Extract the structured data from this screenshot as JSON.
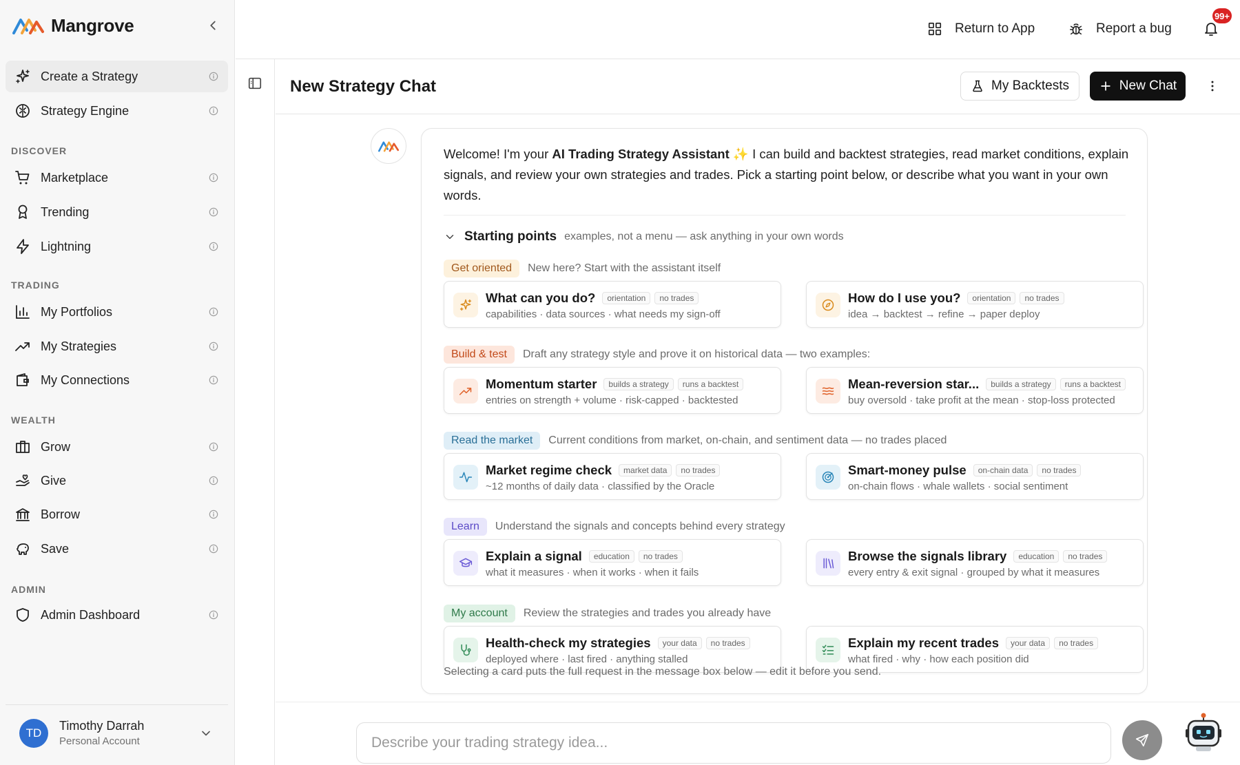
{
  "brand": {
    "name": "Mangrove"
  },
  "sidebar": {
    "primary": [
      {
        "label": "Create a Strategy",
        "icon": "sparkles-icon"
      },
      {
        "label": "Strategy Engine",
        "icon": "brain-icon"
      }
    ],
    "sections": [
      {
        "title": "DISCOVER",
        "items": [
          {
            "label": "Marketplace",
            "icon": "cart-icon"
          },
          {
            "label": "Trending",
            "icon": "award-icon"
          },
          {
            "label": "Lightning",
            "icon": "lightning-icon"
          }
        ]
      },
      {
        "title": "TRADING",
        "items": [
          {
            "label": "My Portfolios",
            "icon": "bar-chart-icon"
          },
          {
            "label": "My Strategies",
            "icon": "trending-up-icon"
          },
          {
            "label": "My Connections",
            "icon": "wallet-icon"
          }
        ]
      },
      {
        "title": "WEALTH",
        "items": [
          {
            "label": "Grow",
            "icon": "briefcase-icon"
          },
          {
            "label": "Give",
            "icon": "hand-heart-icon"
          },
          {
            "label": "Borrow",
            "icon": "bank-icon"
          },
          {
            "label": "Save",
            "icon": "piggy-bank-icon"
          }
        ]
      },
      {
        "title": "ADMIN",
        "items": [
          {
            "label": "Admin Dashboard",
            "icon": "shield-icon"
          }
        ]
      }
    ],
    "user": {
      "initials": "TD",
      "name": "Timothy Darrah",
      "account": "Personal Account"
    }
  },
  "topbar": {
    "return_label": "Return to App",
    "bug_label": "Report a bug",
    "notifications_badge": "99+"
  },
  "chat": {
    "title": "New Strategy Chat",
    "backtests_label": "My Backtests",
    "new_chat_label": "New Chat"
  },
  "welcome": {
    "lead": "Welcome! I'm your ",
    "assistant_name": "AI Trading Strategy Assistant",
    "sparkle": "✨",
    "body": " I can build and backtest strategies, read market conditions, explain signals, and review your own strategies and trades. Pick a starting point below, or describe what you want in your own words."
  },
  "starting_points": {
    "title": "Starting points",
    "subtitle": "examples, not a menu — ask anything in your own words",
    "categories": [
      {
        "label": "Get oriented",
        "desc": "New here? Start with the assistant itself",
        "bg": "#fdf1dc",
        "fg": "#a1581c",
        "options": [
          {
            "name": "What can you do?",
            "tags": [
              "orientation",
              "no trades"
            ],
            "desc": "capabilities · data sources · what needs my sign-off",
            "icon": "sparkles-icon",
            "icon_bg": "#fdf3e3",
            "icon_fg": "#d98a1c"
          },
          {
            "name": "How do I use you?",
            "tags": [
              "orientation",
              "no trades"
            ],
            "desc": "idea → backtest → refine → paper deploy",
            "icon": "compass-icon",
            "icon_bg": "#fdf3e3",
            "icon_fg": "#d98a1c"
          }
        ]
      },
      {
        "label": "Build & test",
        "desc": "Draft any strategy style and prove it on historical data — two examples:",
        "bg": "#fde6dc",
        "fg": "#c24a1a",
        "options": [
          {
            "name": "Momentum starter",
            "tags": [
              "builds a strategy",
              "runs a backtest"
            ],
            "desc": "entries on strength + volume · risk-capped · backtested",
            "icon": "trending-up-icon",
            "icon_bg": "#fdebe2",
            "icon_fg": "#e0622a"
          },
          {
            "name": "Mean-reversion star...",
            "tags": [
              "builds a strategy",
              "runs a backtest"
            ],
            "desc": "buy oversold · take profit at the mean · stop-loss protected",
            "icon": "waves-icon",
            "icon_bg": "#fdebe2",
            "icon_fg": "#e0622a"
          }
        ]
      },
      {
        "label": "Read the market",
        "desc": "Current conditions from market, on-chain, and sentiment data — no trades placed",
        "bg": "#dfeef7",
        "fg": "#2a6f97",
        "options": [
          {
            "name": "Market regime check",
            "tags": [
              "market data",
              "no trades"
            ],
            "desc": "~12 months of daily data · classified by the Oracle",
            "icon": "activity-icon",
            "icon_bg": "#e3f1f8",
            "icon_fg": "#2a86b8"
          },
          {
            "name": "Smart-money pulse",
            "tags": [
              "on-chain data",
              "no trades"
            ],
            "desc": "on-chain flows · whale wallets · social sentiment",
            "icon": "radar-icon",
            "icon_bg": "#e3f1f8",
            "icon_fg": "#2a86b8"
          }
        ]
      },
      {
        "label": "Learn",
        "desc": "Understand the signals and concepts behind every strategy",
        "bg": "#e8e6fb",
        "fg": "#5b4ac7",
        "options": [
          {
            "name": "Explain a signal",
            "tags": [
              "education",
              "no trades"
            ],
            "desc": "what it measures · when it works · when it fails",
            "icon": "graduation-cap-icon",
            "icon_bg": "#eeecfc",
            "icon_fg": "#6a5ad6"
          },
          {
            "name": "Browse the signals library",
            "tags": [
              "education",
              "no trades"
            ],
            "desc": "every entry & exit signal · grouped by what it measures",
            "icon": "library-icon",
            "icon_bg": "#eeecfc",
            "icon_fg": "#6a5ad6"
          }
        ]
      },
      {
        "label": "My account",
        "desc": "Review the strategies and trades you already have",
        "bg": "#e0f2e6",
        "fg": "#2f7a4a",
        "options": [
          {
            "name": "Health-check my strategies",
            "tags": [
              "your data",
              "no trades"
            ],
            "desc": "deployed where · last fired · anything stalled",
            "icon": "stethoscope-icon",
            "icon_bg": "#e5f4ea",
            "icon_fg": "#2f8a55"
          },
          {
            "name": "Explain my recent trades",
            "tags": [
              "your data",
              "no trades"
            ],
            "desc": "what fired · why · how each position did",
            "icon": "list-checks-icon",
            "icon_bg": "#e5f4ea",
            "icon_fg": "#2f8a55"
          }
        ]
      }
    ],
    "footnote": "Selecting a card puts the full request in the message box below — edit it before you send."
  },
  "composer": {
    "placeholder": "Describe your trading strategy idea..."
  }
}
